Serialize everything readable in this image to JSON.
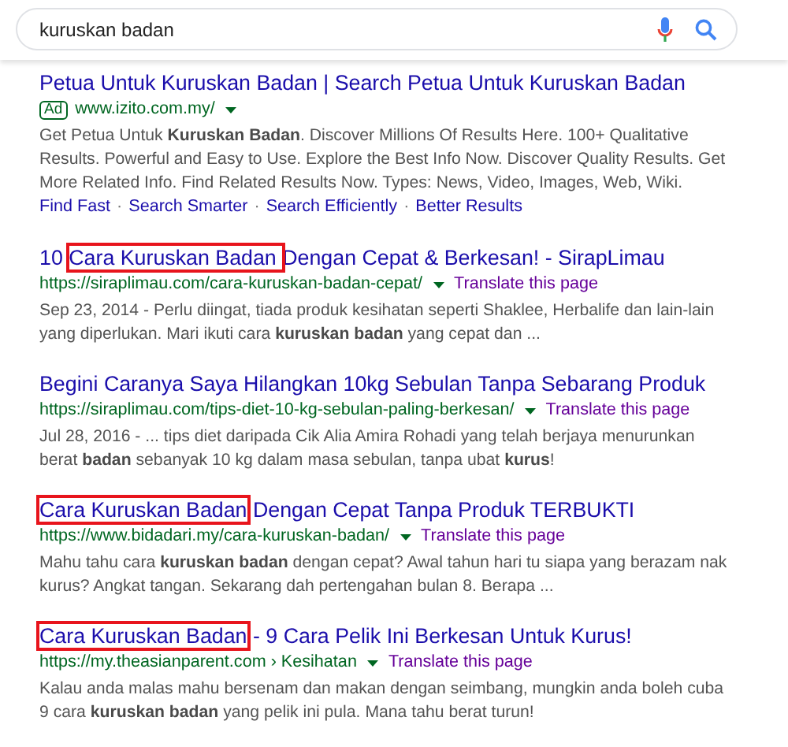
{
  "search": {
    "value": "kuruskan badan"
  },
  "results": [
    {
      "kind": "ad",
      "title_parts": [
        {
          "text": "Petua Untuk Kuruskan Badan | Search Petua Untuk Kuruskan Badan",
          "highlighted": false
        }
      ],
      "badge": "Ad",
      "url": "www.izito.com.my/",
      "snippet": "Get Petua Untuk **Kuruskan Badan**. Discover Millions Of Results Here. 100+ Qualitative Results. Powerful and Easy to Use. Explore the Best Info Now. Discover Quality Results. Get More Related Info. Find Related Results Now. Types: News, Video, Images, Web, Wiki.",
      "sitelink_separator": "·",
      "sitelinks": [
        "Find Fast",
        "Search Smarter",
        "Search Efficiently",
        "Better Results"
      ]
    },
    {
      "kind": "organic",
      "title_parts": [
        {
          "text": "10 ",
          "highlighted": false
        },
        {
          "text": "Cara Kuruskan Badan ",
          "highlighted": true
        },
        {
          "text": "Dengan Cepat & Berkesan! - SirapLimau",
          "highlighted": false
        }
      ],
      "url": "https://siraplimau.com/cara-kuruskan-badan-cepat/",
      "translate": "Translate this page",
      "snippet": "Sep 23, 2014 - Perlu diingat, tiada produk kesihatan seperti Shaklee, Herbalife dan lain-lain yang diperlukan. Mari ikuti cara **kuruskan badan** yang cepat dan ..."
    },
    {
      "kind": "organic",
      "title_parts": [
        {
          "text": "Begini Caranya Saya Hilangkan 10kg Sebulan Tanpa Sebarang Produk",
          "highlighted": false
        }
      ],
      "url": "https://siraplimau.com/tips-diet-10-kg-sebulan-paling-berkesan/",
      "translate": "Translate this page",
      "snippet": "Jul 28, 2016 - ... tips diet daripada Cik Alia Amira Rohadi yang telah berjaya menurunkan berat **badan** sebanyak 10 kg dalam masa sebulan, tanpa ubat **kurus**!"
    },
    {
      "kind": "organic",
      "title_parts": [
        {
          "text": "Cara Kuruskan Badan",
          "highlighted": true
        },
        {
          "text": " Dengan Cepat Tanpa Produk TERBUKTI",
          "highlighted": false
        }
      ],
      "url": "https://www.bidadari.my/cara-kuruskan-badan/",
      "translate": "Translate this page",
      "snippet": "Mahu tahu cara **kuruskan badan** dengan cepat? Awal tahun hari tu siapa yang berazam nak kurus? Angkat tangan. Sekarang dah pertengahan bulan 8. Berapa ..."
    },
    {
      "kind": "organic",
      "title_parts": [
        {
          "text": "Cara Kuruskan Badan",
          "highlighted": true
        },
        {
          "text": " - 9 Cara Pelik Ini Berkesan Untuk Kurus!",
          "highlighted": false
        }
      ],
      "url": "https://my.theasianparent.com › Kesihatan",
      "translate": "Translate this page",
      "snippet": "Kalau anda malas mahu bersenam dan makan dengan seimbang, mungkin anda boleh cuba 9 cara **kuruskan badan** yang pelik ini pula. Mana tahu berat turun!"
    }
  ]
}
